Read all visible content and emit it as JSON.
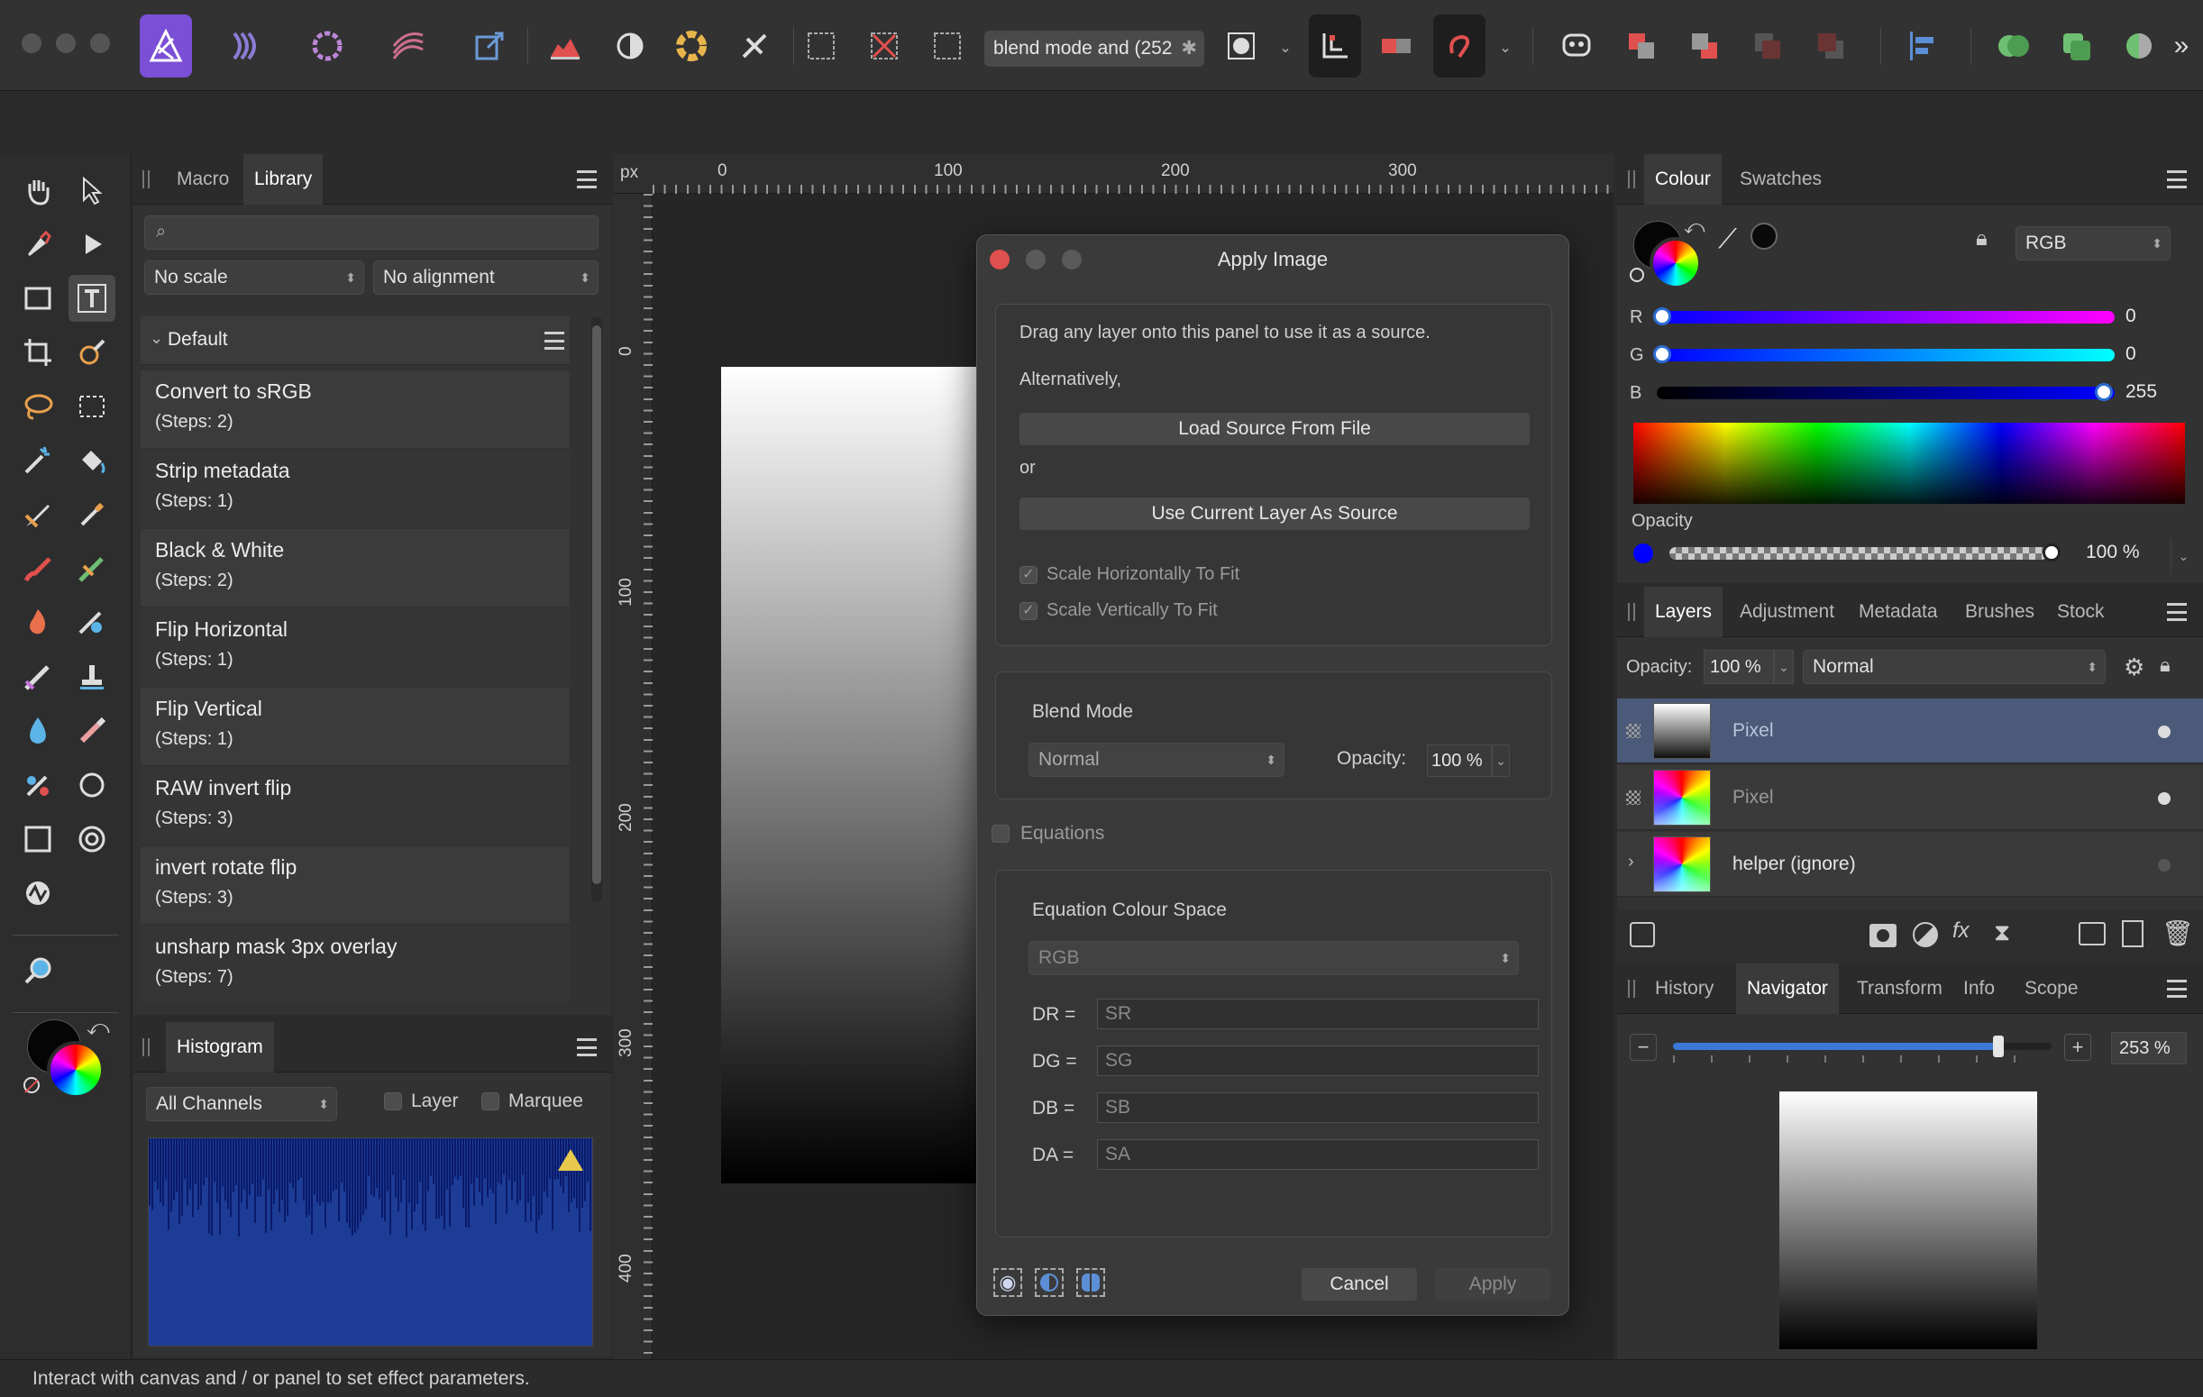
{
  "toolbar": {
    "macro_field": "blend mode and (252",
    "colors": {
      "accent": "#7b4fd6"
    }
  },
  "library": {
    "tabs": [
      "Macro",
      "Library"
    ],
    "active_tab": "Library",
    "search_placeholder": "",
    "scale_select": "No scale",
    "alignment_select": "No alignment",
    "category": "Default",
    "items": [
      {
        "name": "Convert to sRGB",
        "steps": "(Steps: 2)"
      },
      {
        "name": "Strip metadata",
        "steps": "(Steps: 1)"
      },
      {
        "name": "Black & White",
        "steps": "(Steps: 2)"
      },
      {
        "name": "Flip Horizontal",
        "steps": "(Steps: 1)"
      },
      {
        "name": "Flip Vertical",
        "steps": "(Steps: 1)"
      },
      {
        "name": "RAW invert flip",
        "steps": "(Steps: 3)"
      },
      {
        "name": "invert rotate flip",
        "steps": "(Steps: 3)"
      },
      {
        "name": "unsharp mask 3px overlay",
        "steps": "(Steps: 7)"
      }
    ]
  },
  "histogram": {
    "tab": "Histogram",
    "channel_select": "All Channels",
    "layer_label": "Layer",
    "marquee_label": "Marquee"
  },
  "ruler": {
    "unit": "px",
    "h_ticks": [
      "0",
      "100",
      "200",
      "300"
    ],
    "v_ticks": [
      "0",
      "100",
      "200",
      "300",
      "400"
    ]
  },
  "dialog": {
    "title": "Apply Image",
    "drag_text": "Drag any layer onto this panel to use it as a source.",
    "alternatively": "Alternatively,",
    "load_button": "Load Source From File",
    "or": "or",
    "use_current_button": "Use Current Layer As Source",
    "scale_h": "Scale Horizontally To Fit",
    "scale_v": "Scale Vertically To Fit",
    "blend_mode_label": "Blend Mode",
    "blend_mode_value": "Normal",
    "opacity_label": "Opacity:",
    "opacity_value": "100 %",
    "equations_label": "Equations",
    "eq_colour_space_label": "Equation Colour Space",
    "eq_colour_space_value": "RGB",
    "equations": [
      {
        "label": "DR =",
        "value": "SR"
      },
      {
        "label": "DG =",
        "value": "SG"
      },
      {
        "label": "DB =",
        "value": "SB"
      },
      {
        "label": "DA =",
        "value": "SA"
      }
    ],
    "cancel": "Cancel",
    "apply": "Apply"
  },
  "colour": {
    "tabs": [
      "Colour",
      "Swatches"
    ],
    "active_tab": "Colour",
    "model": "RGB",
    "channels": [
      {
        "label": "R",
        "value": "0",
        "fraction": 0.0
      },
      {
        "label": "G",
        "value": "0",
        "fraction": 0.0
      },
      {
        "label": "B",
        "value": "255",
        "fraction": 1.0
      }
    ],
    "opacity_label": "Opacity",
    "opacity_value": "100 %",
    "current_color": "#0000ff"
  },
  "layers": {
    "tabs": [
      "Layers",
      "Adjustment",
      "Metadata",
      "Brushes",
      "Stock"
    ],
    "active_tab": "Layers",
    "opacity_label": "Opacity:",
    "opacity_value": "100 %",
    "blend": "Normal",
    "rows": [
      {
        "name": "Pixel",
        "selected": true
      },
      {
        "name": "Pixel",
        "selected": false
      },
      {
        "name": "helper (ignore)",
        "selected": false
      }
    ]
  },
  "navigator": {
    "tabs": [
      "History",
      "Navigator",
      "Transform",
      "Info",
      "Scope"
    ],
    "active_tab": "Navigator",
    "zoom": "253 %",
    "zoom_fraction": 0.86
  },
  "status": "Interact with canvas and / or panel to set effect parameters."
}
